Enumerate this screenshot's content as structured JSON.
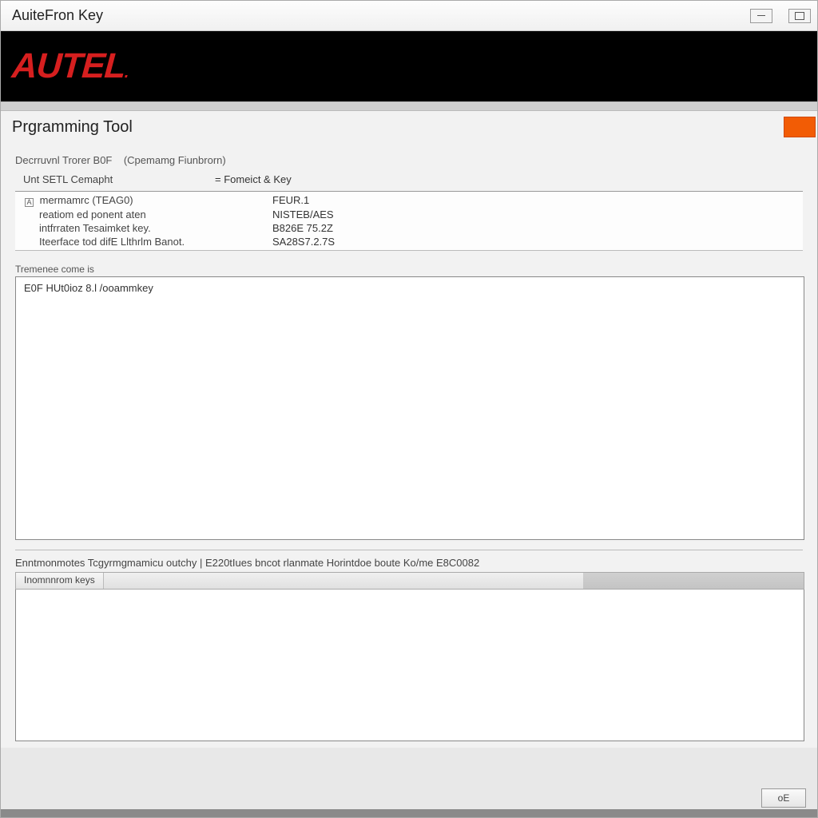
{
  "window": {
    "title": "AuiteFron Key"
  },
  "brand": {
    "name": "AUTEL"
  },
  "panel": {
    "title": "Prgramming Tool"
  },
  "breadcrumb": {
    "left": "Decrruvnl Trorer B0F",
    "right": "(Cpemamg Fiunbrorn)"
  },
  "subheader": {
    "left": "Unt SETL Cemapht",
    "right": "=  Fomeict & Key"
  },
  "info": {
    "rows": [
      {
        "label": "mermamrc (TEAG0)",
        "value": "FEUR.1",
        "checked": true
      },
      {
        "label": "reatiom ed ponent aten",
        "value": "NISTEB/AES"
      },
      {
        "label": "intfrraten Tesaimket key.",
        "value": "B826E 75.2Z"
      },
      {
        "label": "Iteerface tod difE Llthrlm Banot.",
        "value": "SA28S7.2.7S"
      }
    ]
  },
  "section1": {
    "label": "Tremenee come is",
    "content": "E0F HUt0ioz 8.l /ooammkey"
  },
  "status": {
    "text": "Enntmonmotes Tcgyrmgmamicu outchy | E220tIues bncot rlanmate Horintdoe boute Ko/me E8C0082"
  },
  "tabs": {
    "active": "Inomnnrom keys"
  },
  "footer": {
    "ok": "oE"
  }
}
